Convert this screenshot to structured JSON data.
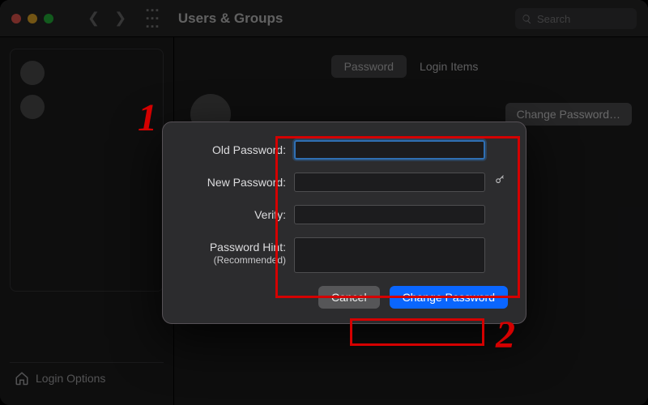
{
  "titlebar": {
    "title": "Users & Groups",
    "search_placeholder": "Search"
  },
  "sidebar": {
    "login_options_label": "Login Options"
  },
  "tabs": {
    "password_label": "Password",
    "login_items_label": "Login Items"
  },
  "user": {
    "change_password_button": "Change Password…"
  },
  "modal": {
    "old_password_label": "Old Password:",
    "new_password_label": "New Password:",
    "verify_label": "Verify:",
    "hint_label_line1": "Password Hint:",
    "hint_label_line2": "(Recommended)",
    "cancel_label": "Cancel",
    "confirm_label": "Change Password"
  },
  "annotations": {
    "num1": "1",
    "num2": "2"
  }
}
